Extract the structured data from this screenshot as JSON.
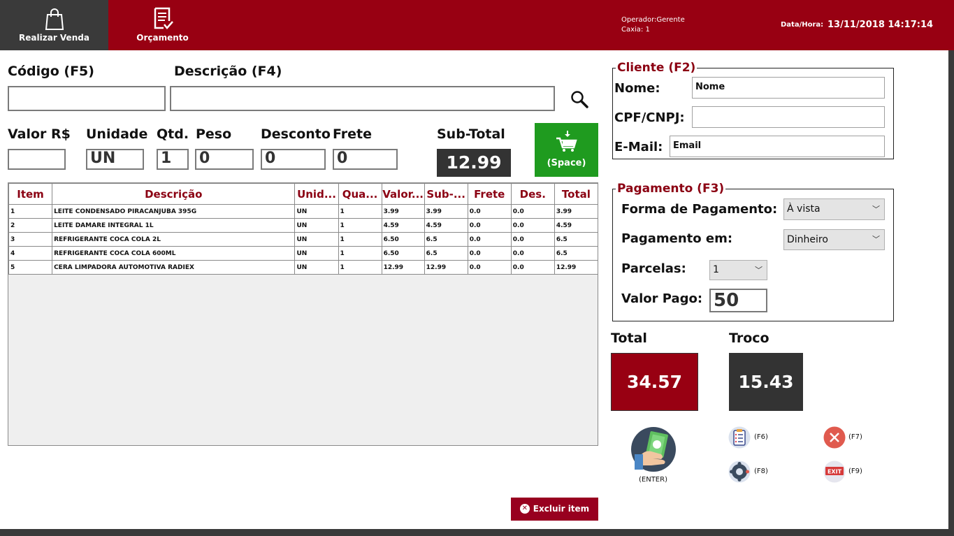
{
  "header": {
    "nav": [
      {
        "label": "Realizar Venda",
        "icon": "shopping-bag-icon"
      },
      {
        "label": "Orçamento",
        "icon": "document-check-icon"
      }
    ],
    "operator": "Operador:Gerente",
    "caixa": "Caxia: 1",
    "datetime_label": "Data/Hora:",
    "datetime_value": "13/11/2018 14:17:14"
  },
  "entry": {
    "codigo_label": "Código (F5)",
    "codigo_value": "",
    "descricao_label": "Descrição (F4)",
    "descricao_value": "",
    "valor_label": "Valor R$",
    "valor_value": "",
    "unidade_label": "Unidade",
    "unidade_value": "UN",
    "qtd_label": "Qtd.",
    "qtd_value": "1",
    "peso_label": "Peso",
    "peso_value": "0",
    "desconto_label": "Desconto",
    "desconto_value": "0",
    "frete_label": "Frete",
    "frete_value": "0",
    "subtotal_label": "Sub-Total",
    "subtotal_value": "12.99",
    "add_button_label": "(Space)",
    "search_icon": "magnifier-icon"
  },
  "table": {
    "columns": [
      "Item",
      "Descrição",
      "Unid...",
      "Qua...",
      "Valor...",
      "Sub-...",
      "Frete",
      "Des.",
      "Total"
    ],
    "rows": [
      [
        "1",
        "LEITE CONDENSADO PIRACANJUBA 395G",
        "UN",
        "1",
        "3.99",
        "3.99",
        "0.0",
        "0.0",
        "3.99"
      ],
      [
        "2",
        "LEITE DAMARE INTEGRAL 1L",
        "UN",
        "1",
        "4.59",
        "4.59",
        "0.0",
        "0.0",
        "4.59"
      ],
      [
        "3",
        "REFRIGERANTE COCA COLA 2L",
        "UN",
        "1",
        "6.50",
        "6.5",
        "0.0",
        "0.0",
        "6.5"
      ],
      [
        "4",
        "REFRIGERANTE COCA COLA 600ML",
        "UN",
        "1",
        "6.50",
        "6.5",
        "0.0",
        "0.0",
        "6.5"
      ],
      [
        "5",
        "CERA LIMPADORA AUTOMOTIVA RADIEX",
        "UN",
        "1",
        "12.99",
        "12.99",
        "0.0",
        "0.0",
        "12.99"
      ]
    ]
  },
  "excluir_label": "Excluir item",
  "cliente": {
    "title": "Cliente (F2)",
    "nome_label": "Nome:",
    "nome_value": "Nome",
    "cpf_label": "CPF/CNPJ:",
    "cpf_value": "",
    "email_label": "E-Mail:",
    "email_value": "Email"
  },
  "pagamento": {
    "title": "Pagamento (F3)",
    "forma_label": "Forma de Pagamento:",
    "forma_value": "À vista",
    "pagamento_em_label": "Pagamento em:",
    "pagamento_em_value": "Dinheiro",
    "parcelas_label": "Parcelas:",
    "parcelas_value": "1",
    "valor_pago_label": "Valor Pago:",
    "valor_pago_value": "50"
  },
  "totals": {
    "total_label": "Total",
    "total_value": "34.57",
    "troco_label": "Troco",
    "troco_value": "15.43"
  },
  "actions": {
    "enter_label": "(ENTER)",
    "f6_label": "(F6)",
    "f7_label": "(F7)",
    "f8_label": "(F8)",
    "f9_label": "(F9)",
    "exit_badge": "EXIT"
  },
  "colors": {
    "brand": "#980012",
    "dark": "#333333",
    "green": "#1f9b1f"
  }
}
